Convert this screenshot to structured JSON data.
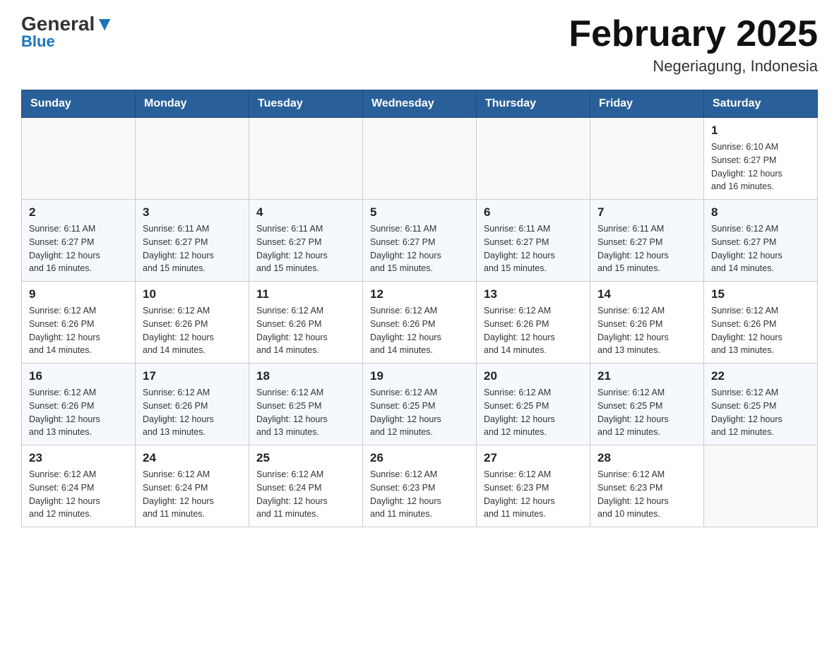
{
  "logo": {
    "general": "General",
    "blue": "Blue"
  },
  "title": "February 2025",
  "location": "Negeriagung, Indonesia",
  "weekdays": [
    "Sunday",
    "Monday",
    "Tuesday",
    "Wednesday",
    "Thursday",
    "Friday",
    "Saturday"
  ],
  "weeks": [
    [
      {
        "day": "",
        "info": ""
      },
      {
        "day": "",
        "info": ""
      },
      {
        "day": "",
        "info": ""
      },
      {
        "day": "",
        "info": ""
      },
      {
        "day": "",
        "info": ""
      },
      {
        "day": "",
        "info": ""
      },
      {
        "day": "1",
        "info": "Sunrise: 6:10 AM\nSunset: 6:27 PM\nDaylight: 12 hours\nand 16 minutes."
      }
    ],
    [
      {
        "day": "2",
        "info": "Sunrise: 6:11 AM\nSunset: 6:27 PM\nDaylight: 12 hours\nand 16 minutes."
      },
      {
        "day": "3",
        "info": "Sunrise: 6:11 AM\nSunset: 6:27 PM\nDaylight: 12 hours\nand 15 minutes."
      },
      {
        "day": "4",
        "info": "Sunrise: 6:11 AM\nSunset: 6:27 PM\nDaylight: 12 hours\nand 15 minutes."
      },
      {
        "day": "5",
        "info": "Sunrise: 6:11 AM\nSunset: 6:27 PM\nDaylight: 12 hours\nand 15 minutes."
      },
      {
        "day": "6",
        "info": "Sunrise: 6:11 AM\nSunset: 6:27 PM\nDaylight: 12 hours\nand 15 minutes."
      },
      {
        "day": "7",
        "info": "Sunrise: 6:11 AM\nSunset: 6:27 PM\nDaylight: 12 hours\nand 15 minutes."
      },
      {
        "day": "8",
        "info": "Sunrise: 6:12 AM\nSunset: 6:27 PM\nDaylight: 12 hours\nand 14 minutes."
      }
    ],
    [
      {
        "day": "9",
        "info": "Sunrise: 6:12 AM\nSunset: 6:26 PM\nDaylight: 12 hours\nand 14 minutes."
      },
      {
        "day": "10",
        "info": "Sunrise: 6:12 AM\nSunset: 6:26 PM\nDaylight: 12 hours\nand 14 minutes."
      },
      {
        "day": "11",
        "info": "Sunrise: 6:12 AM\nSunset: 6:26 PM\nDaylight: 12 hours\nand 14 minutes."
      },
      {
        "day": "12",
        "info": "Sunrise: 6:12 AM\nSunset: 6:26 PM\nDaylight: 12 hours\nand 14 minutes."
      },
      {
        "day": "13",
        "info": "Sunrise: 6:12 AM\nSunset: 6:26 PM\nDaylight: 12 hours\nand 14 minutes."
      },
      {
        "day": "14",
        "info": "Sunrise: 6:12 AM\nSunset: 6:26 PM\nDaylight: 12 hours\nand 13 minutes."
      },
      {
        "day": "15",
        "info": "Sunrise: 6:12 AM\nSunset: 6:26 PM\nDaylight: 12 hours\nand 13 minutes."
      }
    ],
    [
      {
        "day": "16",
        "info": "Sunrise: 6:12 AM\nSunset: 6:26 PM\nDaylight: 12 hours\nand 13 minutes."
      },
      {
        "day": "17",
        "info": "Sunrise: 6:12 AM\nSunset: 6:26 PM\nDaylight: 12 hours\nand 13 minutes."
      },
      {
        "day": "18",
        "info": "Sunrise: 6:12 AM\nSunset: 6:25 PM\nDaylight: 12 hours\nand 13 minutes."
      },
      {
        "day": "19",
        "info": "Sunrise: 6:12 AM\nSunset: 6:25 PM\nDaylight: 12 hours\nand 12 minutes."
      },
      {
        "day": "20",
        "info": "Sunrise: 6:12 AM\nSunset: 6:25 PM\nDaylight: 12 hours\nand 12 minutes."
      },
      {
        "day": "21",
        "info": "Sunrise: 6:12 AM\nSunset: 6:25 PM\nDaylight: 12 hours\nand 12 minutes."
      },
      {
        "day": "22",
        "info": "Sunrise: 6:12 AM\nSunset: 6:25 PM\nDaylight: 12 hours\nand 12 minutes."
      }
    ],
    [
      {
        "day": "23",
        "info": "Sunrise: 6:12 AM\nSunset: 6:24 PM\nDaylight: 12 hours\nand 12 minutes."
      },
      {
        "day": "24",
        "info": "Sunrise: 6:12 AM\nSunset: 6:24 PM\nDaylight: 12 hours\nand 11 minutes."
      },
      {
        "day": "25",
        "info": "Sunrise: 6:12 AM\nSunset: 6:24 PM\nDaylight: 12 hours\nand 11 minutes."
      },
      {
        "day": "26",
        "info": "Sunrise: 6:12 AM\nSunset: 6:23 PM\nDaylight: 12 hours\nand 11 minutes."
      },
      {
        "day": "27",
        "info": "Sunrise: 6:12 AM\nSunset: 6:23 PM\nDaylight: 12 hours\nand 11 minutes."
      },
      {
        "day": "28",
        "info": "Sunrise: 6:12 AM\nSunset: 6:23 PM\nDaylight: 12 hours\nand 10 minutes."
      },
      {
        "day": "",
        "info": ""
      }
    ]
  ]
}
